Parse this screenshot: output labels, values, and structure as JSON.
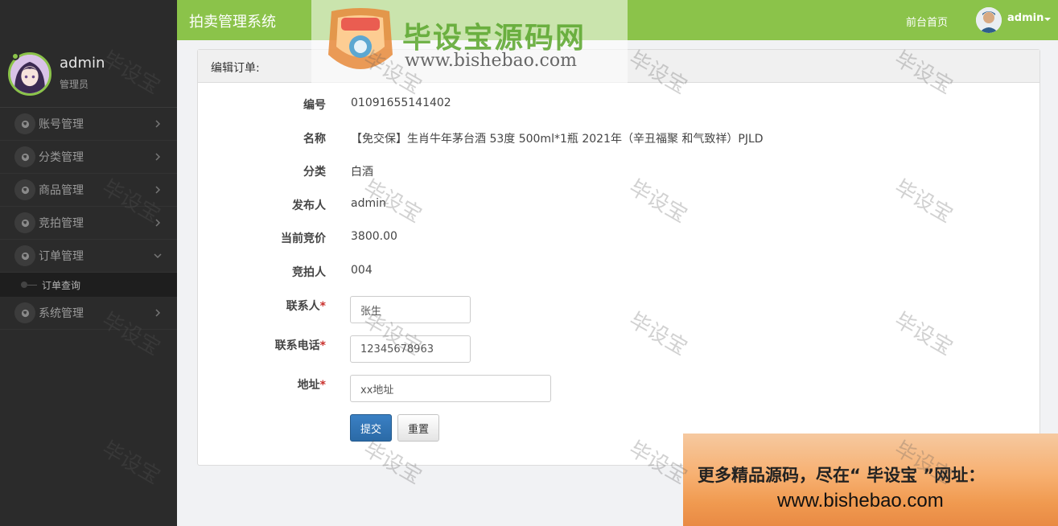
{
  "app": {
    "title": "拍卖管理系统"
  },
  "topbar": {
    "home_link": "前台首页",
    "user": "admin"
  },
  "profile": {
    "name": "admin",
    "role": "管理员"
  },
  "sidebar": {
    "items": [
      {
        "label": "账号管理"
      },
      {
        "label": "分类管理"
      },
      {
        "label": "商品管理"
      },
      {
        "label": "竞拍管理"
      },
      {
        "label": "订单管理"
      }
    ],
    "sub_item": {
      "label": "订单查询"
    },
    "last_item": {
      "label": "系统管理"
    }
  },
  "panel": {
    "title": "编辑订单:",
    "fields": {
      "id": {
        "label": "编号",
        "value": "01091655141402"
      },
      "name": {
        "label": "名称",
        "value": "【免交保】生肖牛年茅台酒 53度 500ml*1瓶 2021年（辛丑福聚 和气致祥）PJLD"
      },
      "category": {
        "label": "分类",
        "value": "白酒"
      },
      "publisher": {
        "label": "发布人",
        "value": "admin"
      },
      "price": {
        "label": "当前竞价",
        "value": "3800.00"
      },
      "bidder": {
        "label": "竞拍人",
        "value": "004"
      },
      "contact": {
        "label": "联系人",
        "value": "张生"
      },
      "phone": {
        "label": "联系电话",
        "value": "12345678963"
      },
      "address": {
        "label": "地址",
        "value": "xx地址"
      }
    },
    "required_mark": "*",
    "submit_label": "提交",
    "reset_label": "重置"
  },
  "watermark": {
    "logo_text": "毕设宝",
    "brand_cn": "毕设宝源码网",
    "url": "www.bishebao.com",
    "tile": "毕设宝",
    "promo_line1": "更多精品源码，尽在“ 毕设宝 ”网址：",
    "promo_line2": "www.bishebao.com"
  },
  "colors": {
    "accent": "#8bc34a",
    "sidebar": "#2b2b2b",
    "primary_button": "#2b6aa6"
  }
}
